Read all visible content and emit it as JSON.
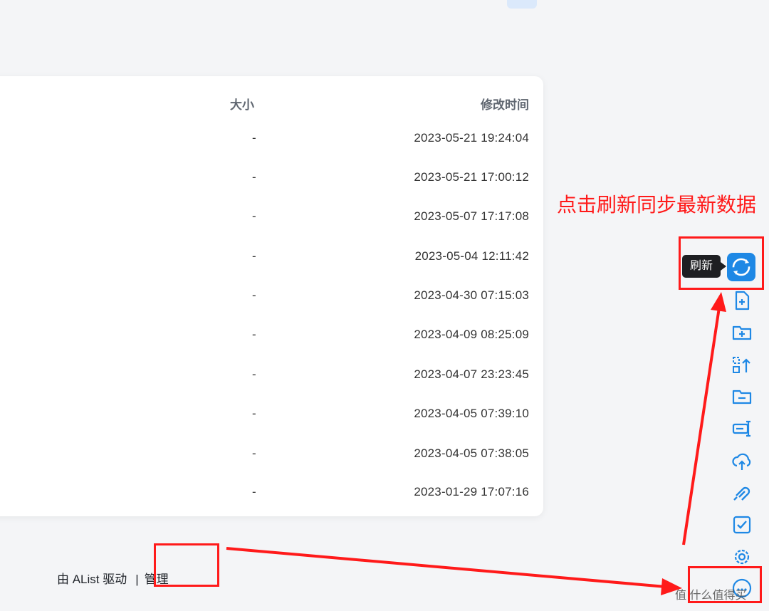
{
  "file_table": {
    "headers": {
      "size": "大小",
      "modified": "修改时间"
    },
    "rows": [
      {
        "size": "-",
        "modified": "2023-05-21 19:24:04"
      },
      {
        "size": "-",
        "modified": "2023-05-21 17:00:12"
      },
      {
        "size": "-",
        "modified": "2023-05-07 17:17:08"
      },
      {
        "size": "-",
        "modified": "2023-05-04 12:11:42"
      },
      {
        "size": "-",
        "modified": "2023-04-30 07:15:03"
      },
      {
        "size": "-",
        "modified": "2023-04-09 08:25:09"
      },
      {
        "size": "-",
        "modified": "2023-04-07 23:23:45"
      },
      {
        "size": "-",
        "modified": "2023-04-05 07:39:10"
      },
      {
        "size": "-",
        "modified": "2023-04-05 07:38:05"
      },
      {
        "size": "-",
        "modified": "2023-01-29 17:07:16"
      }
    ]
  },
  "footer": {
    "powered_by": "由 AList 驱动",
    "separator": "|",
    "manage": "管理"
  },
  "annotation": {
    "text": "点击刷新同步最新数据"
  },
  "toolbar": {
    "tooltip": "刷新",
    "tools": [
      "refresh-icon",
      "new-file-icon",
      "new-folder-icon",
      "recursive-move-icon",
      "folder-icon",
      "rename-icon",
      "upload-icon",
      "offline-download-icon",
      "select-icon",
      "settings-icon",
      "more-icon"
    ]
  },
  "colors": {
    "accent": "#1e88e5",
    "annotation": "#ff1a1a"
  },
  "watermark": "值 什么值得买"
}
